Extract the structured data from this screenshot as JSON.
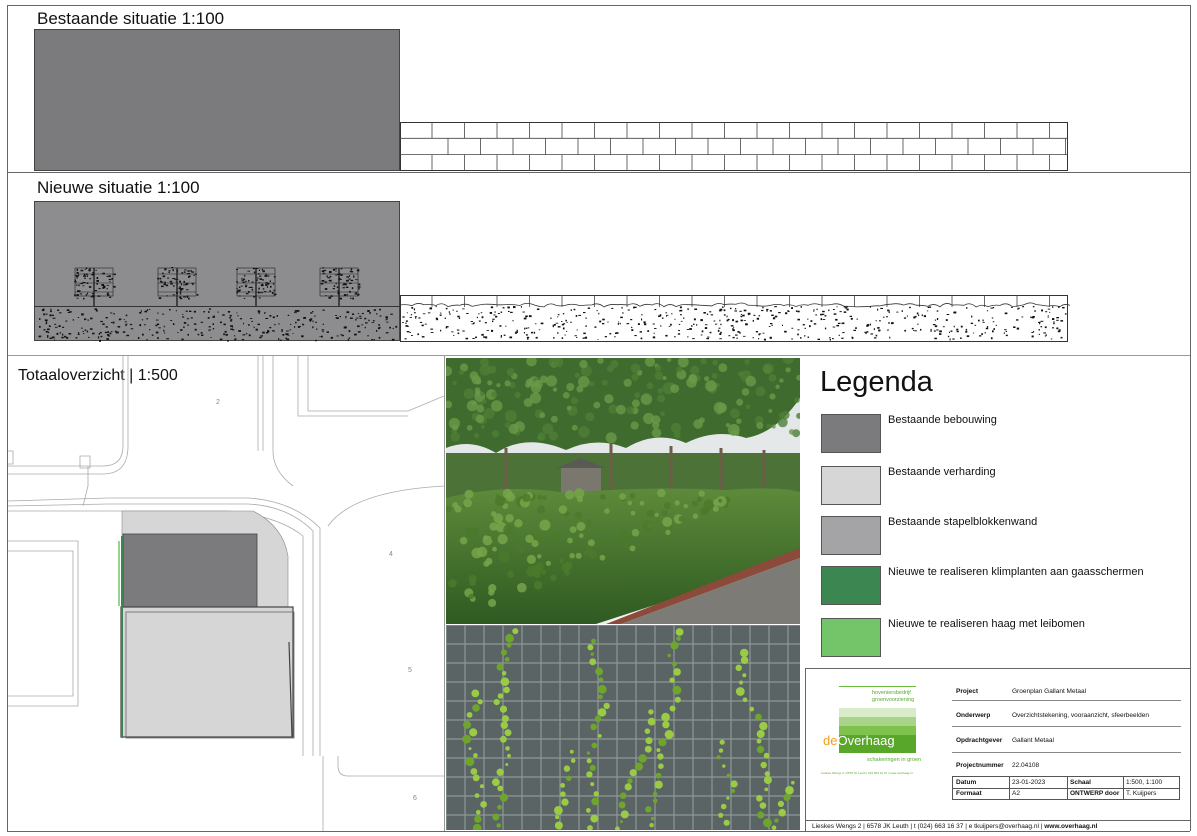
{
  "sections": {
    "existing_title": "Bestaande situatie 1:100",
    "new_title": "Nieuwe situatie 1:100",
    "overview_title": "Totaaloverzicht | 1:500"
  },
  "map_labels": [
    "2",
    "4",
    "5",
    "6"
  ],
  "legend": {
    "title": "Legenda",
    "items": [
      {
        "label": "Bestaande bebouwing",
        "color": "#7b7b7d"
      },
      {
        "label": "Bestaande verharding",
        "color": "#d6d6d7"
      },
      {
        "label": "Bestaande stapelblokkenwand",
        "color": "#a4a4a6"
      },
      {
        "label": "Nieuwe te realiseren klimplanten aan gaasschermen",
        "color": "#3c8651"
      },
      {
        "label": "Nieuwe te realiseren haag met leibomen",
        "color": "#74c56a"
      }
    ]
  },
  "logo": {
    "top_line1": "hoveniersbedrijf",
    "top_line2": "groenvoorziening",
    "brand_de": "de",
    "brand_name": "Overhaag",
    "tagline": "schakeringen in groen",
    "address_small": "Lieskes Wengs 2 | 6578 JK Leuth | 024 663 16 37 | www.overhaag.nl"
  },
  "title_block": {
    "project_label": "Project",
    "project_value": "Groenplan Gallant Metaal",
    "subject_label": "Onderwerp",
    "subject_value": "Overzichtstekening, vooraanzicht, sfeerbeelden",
    "client_label": "Opdrachtgever",
    "client_value": "Gallant Metaal",
    "number_label": "Projectnummer",
    "number_value": "22.04108",
    "date_label": "Datum",
    "date_value": "23-01-2023",
    "scale_label": "Schaal",
    "scale_value": "1:500, 1:100",
    "format_label": "Formaat",
    "format_value": "A2",
    "design_label": "ONTWERP door",
    "design_value": "T. Kuijpers"
  },
  "footer": {
    "address": "Lieskes Wengs 2  |  6578 JK Leuth  |  t (024) 663 16 37  |  e  tkuijpers@overhaag.nl  |",
    "website": "www.overhaag.nl"
  }
}
